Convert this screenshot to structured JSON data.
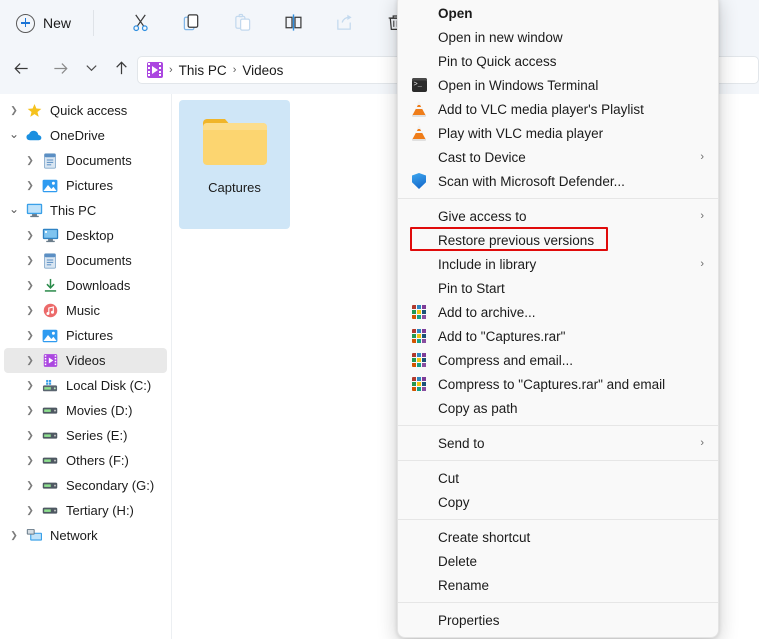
{
  "window": {
    "title": "File Explorer",
    "breadcrumb": [
      "This PC",
      "Videos"
    ],
    "breadcrumb_separator": "›"
  },
  "toolbar": {
    "new_label": "New",
    "icons": [
      {
        "name": "cut-icon",
        "label": "Cut",
        "enabled": true
      },
      {
        "name": "copy-icon",
        "label": "Copy",
        "enabled": true
      },
      {
        "name": "paste-icon",
        "label": "Paste",
        "enabled": false
      },
      {
        "name": "rename-icon",
        "label": "Rename",
        "enabled": true
      },
      {
        "name": "share-icon",
        "label": "Share",
        "enabled": false
      },
      {
        "name": "delete-icon",
        "label": "Delete",
        "enabled": true
      }
    ]
  },
  "navbar": {
    "back": "Back",
    "forward": "Forward",
    "recent": "Recent locations",
    "up": "Up"
  },
  "sidebar": {
    "items": [
      {
        "label": "Quick access",
        "icon": "star-icon",
        "indent": 1,
        "expander": "collapsed",
        "selected": false
      },
      {
        "label": "OneDrive",
        "icon": "cloud-icon",
        "indent": 1,
        "expander": "expanded",
        "selected": false
      },
      {
        "label": "Documents",
        "icon": "documents-icon",
        "indent": 2,
        "expander": "collapsed",
        "selected": false
      },
      {
        "label": "Pictures",
        "icon": "pictures-icon",
        "indent": 2,
        "expander": "collapsed",
        "selected": false
      },
      {
        "label": "This PC",
        "icon": "this-pc-icon",
        "indent": 1,
        "expander": "expanded",
        "selected": false
      },
      {
        "label": "Desktop",
        "icon": "desktop-icon",
        "indent": 2,
        "expander": "collapsed",
        "selected": false
      },
      {
        "label": "Documents",
        "icon": "documents-icon",
        "indent": 2,
        "expander": "collapsed",
        "selected": false
      },
      {
        "label": "Downloads",
        "icon": "downloads-icon",
        "indent": 2,
        "expander": "collapsed",
        "selected": false
      },
      {
        "label": "Music",
        "icon": "music-icon",
        "indent": 2,
        "expander": "collapsed",
        "selected": false
      },
      {
        "label": "Pictures",
        "icon": "pictures-icon",
        "indent": 2,
        "expander": "collapsed",
        "selected": false
      },
      {
        "label": "Videos",
        "icon": "videos-icon",
        "indent": 2,
        "expander": "collapsed",
        "selected": true
      },
      {
        "label": "Local Disk (C:)",
        "icon": "system-drive-icon",
        "indent": 2,
        "expander": "collapsed",
        "selected": false
      },
      {
        "label": "Movies (D:)",
        "icon": "drive-icon",
        "indent": 2,
        "expander": "collapsed",
        "selected": false
      },
      {
        "label": "Series (E:)",
        "icon": "drive-icon",
        "indent": 2,
        "expander": "collapsed",
        "selected": false
      },
      {
        "label": "Others (F:)",
        "icon": "drive-icon",
        "indent": 2,
        "expander": "collapsed",
        "selected": false
      },
      {
        "label": "Secondary (G:)",
        "icon": "drive-icon",
        "indent": 2,
        "expander": "collapsed",
        "selected": false
      },
      {
        "label": "Tertiary (H:)",
        "icon": "drive-icon",
        "indent": 2,
        "expander": "collapsed",
        "selected": false
      },
      {
        "label": "Network",
        "icon": "network-icon",
        "indent": 1,
        "expander": "collapsed",
        "selected": false
      }
    ]
  },
  "content": {
    "files": [
      {
        "name": "Captures",
        "icon": "folder-icon",
        "selected": true
      }
    ]
  },
  "context_menu": {
    "highlighted_item": "Restore previous versions",
    "highlight_color": "#e00b0b",
    "groups": [
      {
        "items": [
          {
            "label": "Open",
            "icon": null,
            "bold": true,
            "submenu": false
          },
          {
            "label": "Open in new window",
            "icon": null,
            "bold": false,
            "submenu": false
          },
          {
            "label": "Pin to Quick access",
            "icon": null,
            "bold": false,
            "submenu": false
          },
          {
            "label": "Open in Windows Terminal",
            "icon": "terminal-icon",
            "bold": false,
            "submenu": false
          },
          {
            "label": "Add to VLC media player's Playlist",
            "icon": "vlc-icon",
            "bold": false,
            "submenu": false
          },
          {
            "label": "Play with VLC media player",
            "icon": "vlc-icon",
            "bold": false,
            "submenu": false
          },
          {
            "label": "Cast to Device",
            "icon": null,
            "bold": false,
            "submenu": true
          },
          {
            "label": "Scan with Microsoft Defender...",
            "icon": "defender-shield-icon",
            "bold": false,
            "submenu": false
          }
        ]
      },
      {
        "items": [
          {
            "label": "Give access to",
            "icon": null,
            "bold": false,
            "submenu": true
          },
          {
            "label": "Restore previous versions",
            "icon": null,
            "bold": false,
            "submenu": false,
            "highlighted": true
          },
          {
            "label": "Include in library",
            "icon": null,
            "bold": false,
            "submenu": true
          },
          {
            "label": "Pin to Start",
            "icon": null,
            "bold": false,
            "submenu": false
          },
          {
            "label": "Add to archive...",
            "icon": "winrar-icon",
            "bold": false,
            "submenu": false
          },
          {
            "label": "Add to \"Captures.rar\"",
            "icon": "winrar-icon",
            "bold": false,
            "submenu": false
          },
          {
            "label": "Compress and email...",
            "icon": "winrar-icon",
            "bold": false,
            "submenu": false
          },
          {
            "label": "Compress to \"Captures.rar\" and email",
            "icon": "winrar-icon",
            "bold": false,
            "submenu": false
          },
          {
            "label": "Copy as path",
            "icon": null,
            "bold": false,
            "submenu": false
          }
        ]
      },
      {
        "items": [
          {
            "label": "Send to",
            "icon": null,
            "bold": false,
            "submenu": true
          }
        ]
      },
      {
        "items": [
          {
            "label": "Cut",
            "icon": null,
            "bold": false,
            "submenu": false
          },
          {
            "label": "Copy",
            "icon": null,
            "bold": false,
            "submenu": false
          }
        ]
      },
      {
        "items": [
          {
            "label": "Create shortcut",
            "icon": null,
            "bold": false,
            "submenu": false
          },
          {
            "label": "Delete",
            "icon": null,
            "bold": false,
            "submenu": false
          },
          {
            "label": "Rename",
            "icon": null,
            "bold": false,
            "submenu": false
          }
        ]
      },
      {
        "items": [
          {
            "label": "Properties",
            "icon": null,
            "bold": false,
            "submenu": false
          }
        ]
      }
    ],
    "submenu_arrow": "›"
  }
}
